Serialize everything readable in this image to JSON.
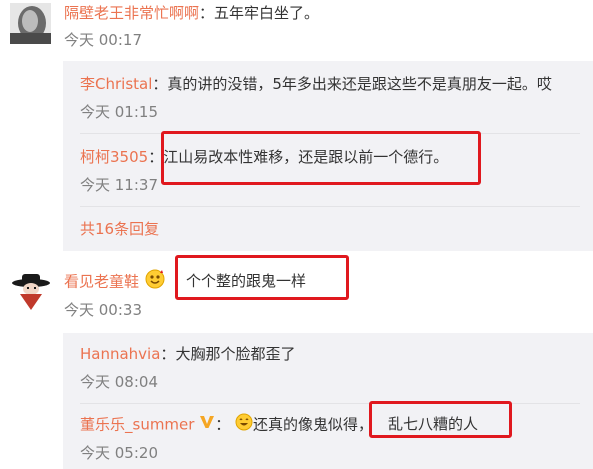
{
  "thread1": {
    "author": "隔壁老王非常忙啊啊",
    "colon": "：",
    "text": "五年牢白坐了。",
    "time": "今天 00:17",
    "replies": [
      {
        "author": "李Christal",
        "colon": "：",
        "text": "真的讲的没错，5年多出来还是跟这些不是真朋友一起。哎",
        "time": "今天 01:15"
      },
      {
        "author": "柯柯3505",
        "colon": "：",
        "text": "江山易改本性难移，还是跟以前一个德行。",
        "time": "今天 11:37"
      }
    ],
    "more_replies": "共16条回复"
  },
  "thread2": {
    "author": "看见老童鞋",
    "badge_icon": "emoji-badge-icon",
    "text": "个个整的跟鬼一样",
    "time": "今天 00:33",
    "replies": [
      {
        "author": "Hannahvia",
        "colon": "：",
        "text": "大胸那个脸都歪了",
        "time": "今天 08:04"
      },
      {
        "author": "董乐乐_summer",
        "colon": "：",
        "text_prefix": "还真的像鬼似得，",
        "text_highlight": "乱七八糟的人",
        "time": "今天 05:20"
      }
    ]
  },
  "colors": {
    "name": "#eb7350",
    "text": "#333333",
    "time": "#808080",
    "reply_bg": "#f2f2f5",
    "highlight_box": "#e0181e",
    "vip_badge": "#f5a623"
  }
}
